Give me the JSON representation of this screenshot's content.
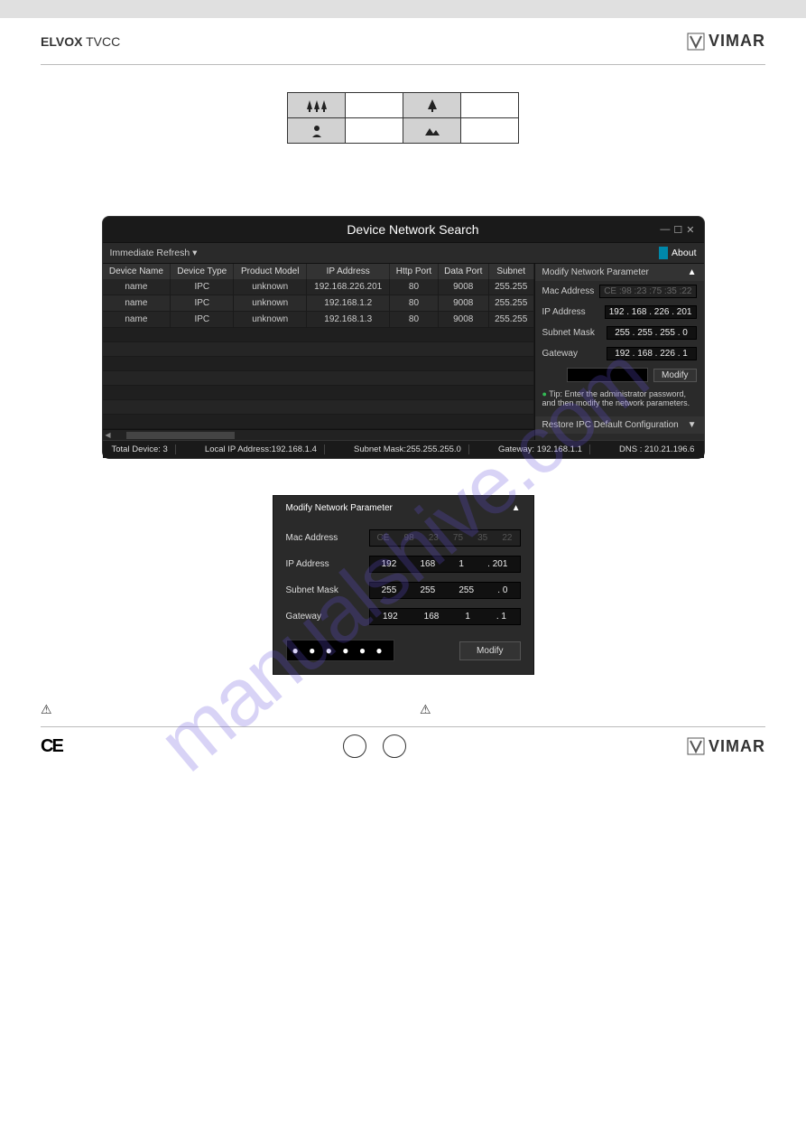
{
  "header": {
    "brand_bold": "ELVOX",
    "brand_light": "TVCC",
    "logo_text": "VIMAR"
  },
  "watermark": "manualshive.com",
  "network_search": {
    "title": "Device Network Search",
    "refresh_label": "Immediate Refresh ▾",
    "about_label": "About",
    "columns": {
      "device_name": "Device Name",
      "device_type": "Device Type",
      "product_model": "Product Model",
      "ip_address": "IP Address",
      "http_port": "Http Port",
      "data_port": "Data Port",
      "subnet": "Subnet"
    },
    "rows": [
      {
        "name": "name",
        "type": "IPC",
        "model": "unknown",
        "ip": "192.168.226.201",
        "http": "80",
        "data": "9008",
        "subnet": "255.255"
      },
      {
        "name": "name",
        "type": "IPC",
        "model": "unknown",
        "ip": "192.168.1.2",
        "http": "80",
        "data": "9008",
        "subnet": "255.255"
      },
      {
        "name": "name",
        "type": "IPC",
        "model": "unknown",
        "ip": "192.168.1.3",
        "http": "80",
        "data": "9008",
        "subnet": "255.255"
      }
    ],
    "panel": {
      "title": "Modify Network Parameter",
      "mac_label": "Mac Address",
      "mac_value": "CE :98 :23 :75 :35 :22",
      "ip_label": "IP Address",
      "ip_value": "192 . 168 . 226 . 201",
      "subnet_label": "Subnet Mask",
      "subnet_value": "255 . 255 . 255 . 0",
      "gateway_label": "Gateway",
      "gateway_value": "192 . 168 . 226 . 1",
      "modify_label": "Modify",
      "tip": "Tip: Enter the administrator password, and then modify the network parameters.",
      "restore_label": "Restore IPC Default Configuration"
    },
    "status": {
      "total": "Total Device: 3",
      "local_ip": "Local IP Address:192.168.1.4",
      "subnet": "Subnet Mask:255.255.255.0",
      "gateway": "Gateway: 192.168.1.1",
      "dns": "DNS : 210.21.196.6"
    }
  },
  "modify_panel2": {
    "title": "Modify Network Parameter",
    "mac_label": "Mac Address",
    "mac": [
      "CE",
      "98",
      "23",
      "75",
      "35",
      "22"
    ],
    "ip_label": "IP Address",
    "ip": [
      "192",
      "168",
      "1",
      ". 201"
    ],
    "subnet_label": "Subnet Mask",
    "subnet": [
      "255",
      "255",
      "255",
      ". 0"
    ],
    "gateway_label": "Gateway",
    "gateway": [
      "192",
      "168",
      "1",
      ". 1"
    ],
    "password_dots": "● ● ● ● ● ●",
    "modify_label": "Modify"
  },
  "footer": {
    "ce": "CE",
    "logo_text": "VIMAR"
  }
}
